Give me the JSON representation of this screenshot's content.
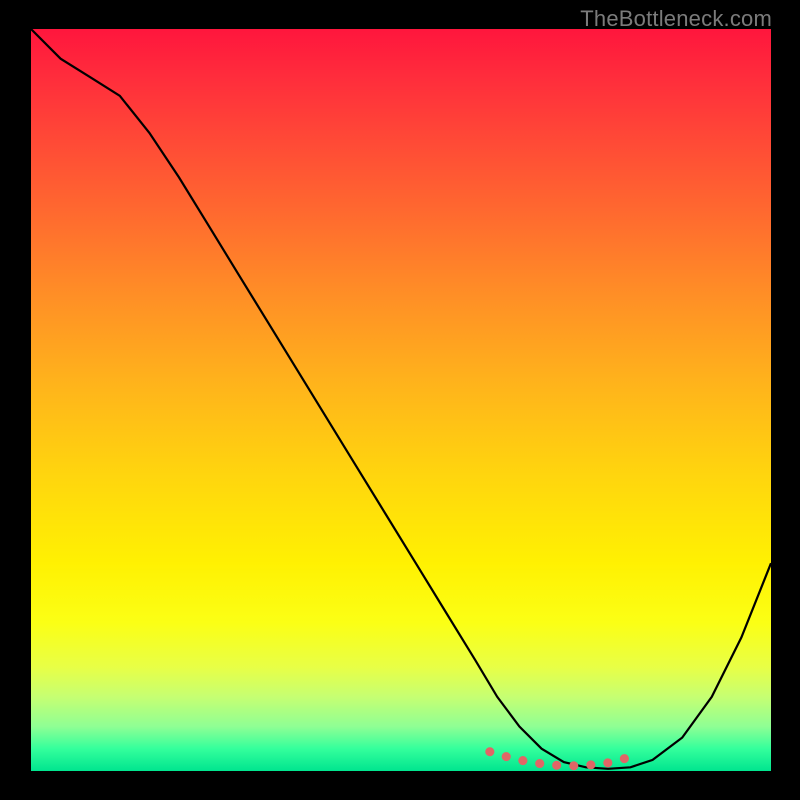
{
  "watermark": "TheBottleneck.com",
  "colors": {
    "frame": "#000000",
    "gradient_top": "#ff163d",
    "gradient_bottom": "#00e58f",
    "curve": "#000000",
    "dots": "#e06666"
  },
  "chart_data": {
    "type": "line",
    "title": "",
    "xlabel": "",
    "ylabel": "",
    "xlim": [
      0,
      100
    ],
    "ylim": [
      0,
      100
    ],
    "series": [
      {
        "name": "bottleneck-curve",
        "x": [
          0,
          4,
          8,
          12,
          16,
          20,
          24,
          28,
          32,
          36,
          40,
          44,
          48,
          52,
          56,
          60,
          63,
          66,
          69,
          72,
          75,
          78,
          81,
          84,
          88,
          92,
          96,
          100
        ],
        "y": [
          100,
          96,
          93.5,
          91,
          86,
          80,
          73.5,
          67,
          60.5,
          54,
          47.5,
          41,
          34.5,
          28,
          21.5,
          15,
          10,
          6,
          3,
          1.2,
          0.5,
          0.3,
          0.5,
          1.5,
          4.5,
          10,
          18,
          28
        ]
      }
    ],
    "highlight_dots": {
      "name": "optimal-range",
      "x": [
        62,
        64,
        66,
        68,
        70,
        72,
        74,
        76,
        78,
        80,
        82
      ],
      "y": [
        2.6,
        2.0,
        1.5,
        1.1,
        0.85,
        0.7,
        0.7,
        0.85,
        1.1,
        1.6,
        2.3
      ]
    }
  }
}
